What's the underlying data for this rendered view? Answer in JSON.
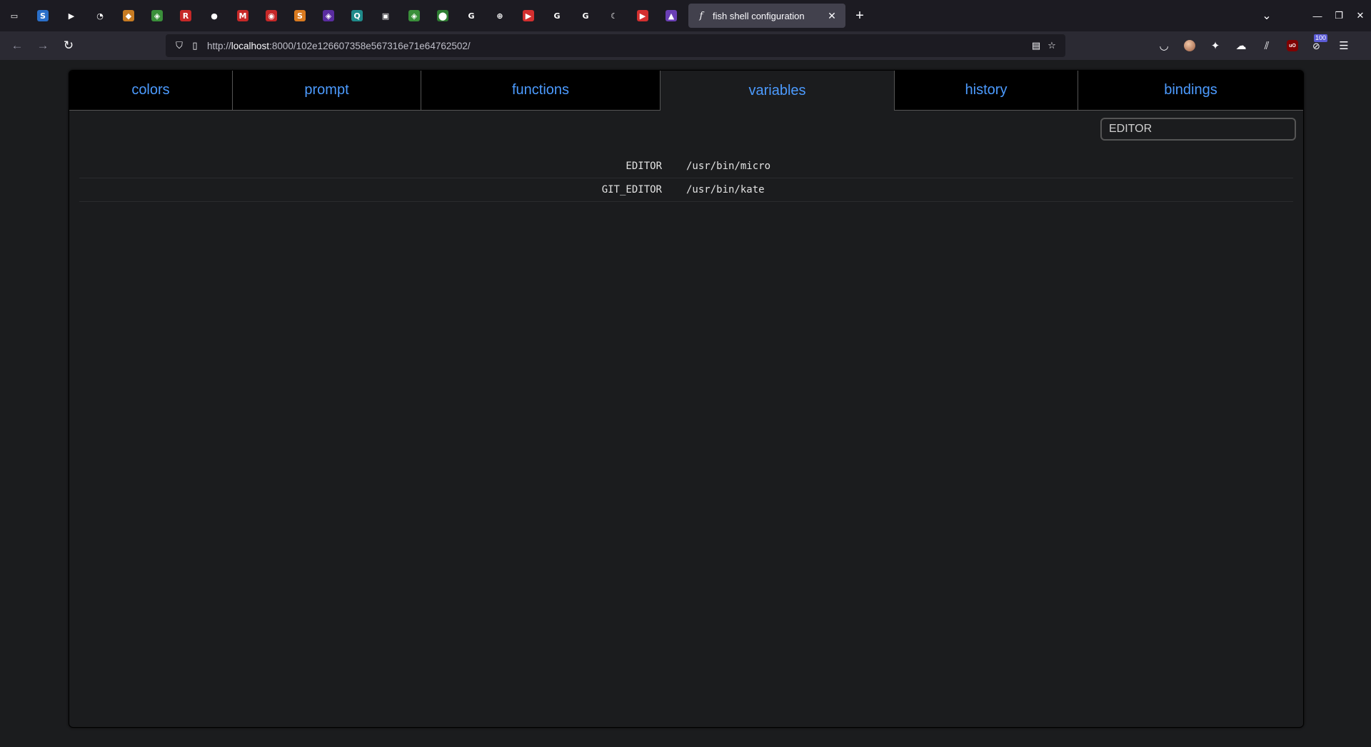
{
  "browser": {
    "active_tab": {
      "favicon": "f",
      "title": "fish shell configuration",
      "close": "✕"
    },
    "new_tab": "+",
    "list_all_tabs": "⌄",
    "window": {
      "minimize": "—",
      "restore": "❐",
      "close": "✕"
    },
    "pinned_tabs": [
      {
        "icon": "tab-overview-icon",
        "glyph": "▭",
        "color": "#1c1b22"
      },
      {
        "icon": "slides-icon",
        "glyph": "S",
        "color": "#2a6fc9"
      },
      {
        "icon": "play-icon",
        "glyph": "▶",
        "color": "#1c1b22"
      },
      {
        "icon": "globe-play-icon",
        "glyph": "◔",
        "color": "#1c1b22"
      },
      {
        "icon": "shield-icon",
        "glyph": "◆",
        "color": "#c77b22"
      },
      {
        "icon": "puzzle-icon",
        "glyph": "◈",
        "color": "#3a8f3a"
      },
      {
        "icon": "r-icon",
        "glyph": "R",
        "color": "#c62828"
      },
      {
        "icon": "github-icon",
        "glyph": "●",
        "color": "#1c1b22"
      },
      {
        "icon": "gmail-icon",
        "glyph": "M",
        "color": "#c62828"
      },
      {
        "icon": "target-icon",
        "glyph": "◉",
        "color": "#c62828"
      },
      {
        "icon": "s-coin-icon",
        "glyph": "S",
        "color": "#d97a1f"
      },
      {
        "icon": "shield-purple-icon",
        "glyph": "◈",
        "color": "#5a2ca0"
      },
      {
        "icon": "q-icon",
        "glyph": "Q",
        "color": "#1f8a8a"
      },
      {
        "icon": "monitor-icon",
        "glyph": "▣",
        "color": "#1c1b22"
      },
      {
        "icon": "puzzle-icon-2",
        "glyph": "◈",
        "color": "#3a8f3a"
      },
      {
        "icon": "maps-pin-icon",
        "glyph": "⬤",
        "color": "#2e7d32"
      },
      {
        "icon": "google-icon",
        "glyph": "G",
        "color": "#1c1b22"
      },
      {
        "icon": "globe-icon",
        "glyph": "⊕",
        "color": "#1c1b22"
      },
      {
        "icon": "youtube-icon",
        "glyph": "▶",
        "color": "#d32f2f"
      },
      {
        "icon": "google-icon-2",
        "glyph": "G",
        "color": "#1c1b22"
      },
      {
        "icon": "google-icon-3",
        "glyph": "G",
        "color": "#1c1b22"
      },
      {
        "icon": "moon-icon",
        "glyph": "☾",
        "color": "#1c1b22"
      },
      {
        "icon": "youtube-icon-2",
        "glyph": "▶",
        "color": "#d32f2f"
      },
      {
        "icon": "triangle-icon",
        "glyph": "▲",
        "color": "#6a3fb5"
      }
    ],
    "url": {
      "scheme": "http://",
      "host": "localhost",
      "rest": ":8000/102e126607358e567316e71e64762502/"
    },
    "extension_badge": "100"
  },
  "page": {
    "tabs": [
      {
        "label": "colors",
        "name": "tab-colors",
        "selected": false
      },
      {
        "label": "prompt",
        "name": "tab-prompt",
        "selected": false
      },
      {
        "label": "functions",
        "name": "tab-functions",
        "selected": false
      },
      {
        "label": "variables",
        "name": "tab-variables",
        "selected": true
      },
      {
        "label": "history",
        "name": "tab-history",
        "selected": false
      },
      {
        "label": "bindings",
        "name": "tab-bindings",
        "selected": false
      }
    ],
    "filter": {
      "value": "EDITOR"
    },
    "variables": [
      {
        "name": "EDITOR",
        "value": "/usr/bin/micro"
      },
      {
        "name": "GIT_EDITOR",
        "value": "/usr/bin/kate"
      }
    ],
    "colors": {
      "tab_text": "#4c9bff",
      "tab_bg": "#000000",
      "panel_bg": "#1b1c1e"
    }
  }
}
